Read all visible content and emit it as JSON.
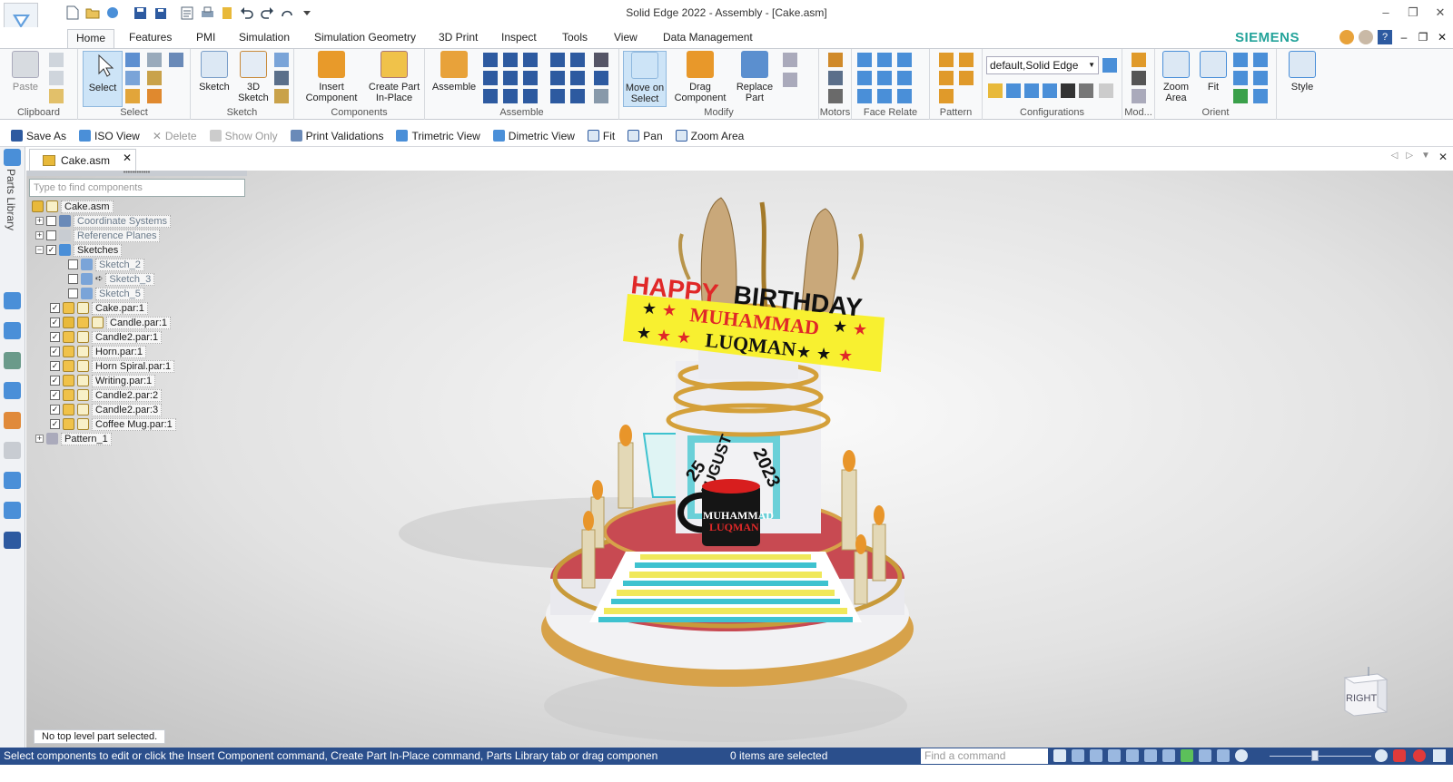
{
  "window": {
    "title": "Solid Edge 2022 - Assembly - [Cake.asm]"
  },
  "brand": "SIEMENS",
  "ribbon_tabs": [
    "Home",
    "Features",
    "PMI",
    "Simulation",
    "Simulation Geometry",
    "3D Print",
    "Inspect",
    "Tools",
    "View",
    "Data Management"
  ],
  "ribbon": {
    "paste": "Paste",
    "select": "Select",
    "sketch": "Sketch",
    "sketch3d_1": "3D",
    "sketch3d_2": "Sketch",
    "insert_1": "Insert",
    "insert_2": "Component",
    "createpart_1": "Create Part",
    "createpart_2": "In-Place",
    "assemble": "Assemble",
    "move_1": "Move on",
    "move_2": "Select",
    "drag_1": "Drag",
    "drag_2": "Component",
    "replace_1": "Replace",
    "replace_2": "Part",
    "zoom_1": "Zoom",
    "zoom_2": "Area",
    "fit": "Fit",
    "style": "Style",
    "configuration": "default,Solid Edge",
    "groups": {
      "clipboard": "Clipboard",
      "select": "Select",
      "sketch": "Sketch",
      "components": "Components",
      "assemble": "Assemble",
      "modify": "Modify",
      "motors": "Motors",
      "face_relate": "Face Relate",
      "pattern": "Pattern",
      "configurations": "Configurations",
      "modify_short": "Mod...",
      "orient": "Orient"
    }
  },
  "command_bar": [
    {
      "label": "Save As",
      "enabled": true
    },
    {
      "label": "ISO View",
      "enabled": true
    },
    {
      "label": "Delete",
      "enabled": false
    },
    {
      "label": "Show Only",
      "enabled": false
    },
    {
      "label": "Print Validations",
      "enabled": true
    },
    {
      "label": "Trimetric View",
      "enabled": true
    },
    {
      "label": "Dimetric View",
      "enabled": true
    },
    {
      "label": "Fit",
      "enabled": true
    },
    {
      "label": "Pan",
      "enabled": true
    },
    {
      "label": "Zoom Area",
      "enabled": true
    }
  ],
  "document_tab": "Cake.asm",
  "sidebar": {
    "parts_library": "Parts Library"
  },
  "tree": {
    "search_placeholder": "Type to find components",
    "root": "Cake.asm",
    "coordinate_systems": "Coordinate Systems",
    "reference_planes": "Reference Planes",
    "sketches": "Sketches",
    "sketch_2": "Sketch_2",
    "sketch_3": "Sketch_3",
    "sketch_5": "Sketch_5",
    "parts": [
      "Cake.par:1",
      "Candle.par:1",
      "Candle2.par:1",
      "Horn.par:1",
      "Horn Spiral.par:1",
      "Writing.par:1",
      "Candle2.par:2",
      "Candle2.par:3",
      "Coffee Mug.par:1"
    ],
    "pattern": "Pattern_1"
  },
  "scene": {
    "banner_happy": "HAPPY",
    "banner_birthday": "BIRTHDAY",
    "name_first": "MUHAMMAD",
    "name_last": "LUQMAN",
    "date_day": "25",
    "date_month": "AUGUST",
    "date_year": "2023",
    "mug_line1": "MUHAMMAD",
    "mug_line2": "LUQMAN"
  },
  "viewcube": {
    "label": "RIGHT"
  },
  "message": "No top level part selected.",
  "status": {
    "message": "Select components to edit or click the Insert Component command, Create Part In-Place command, Parts Library tab or drag componen",
    "selection": "0 items are selected",
    "find_placeholder": "Find a command"
  }
}
